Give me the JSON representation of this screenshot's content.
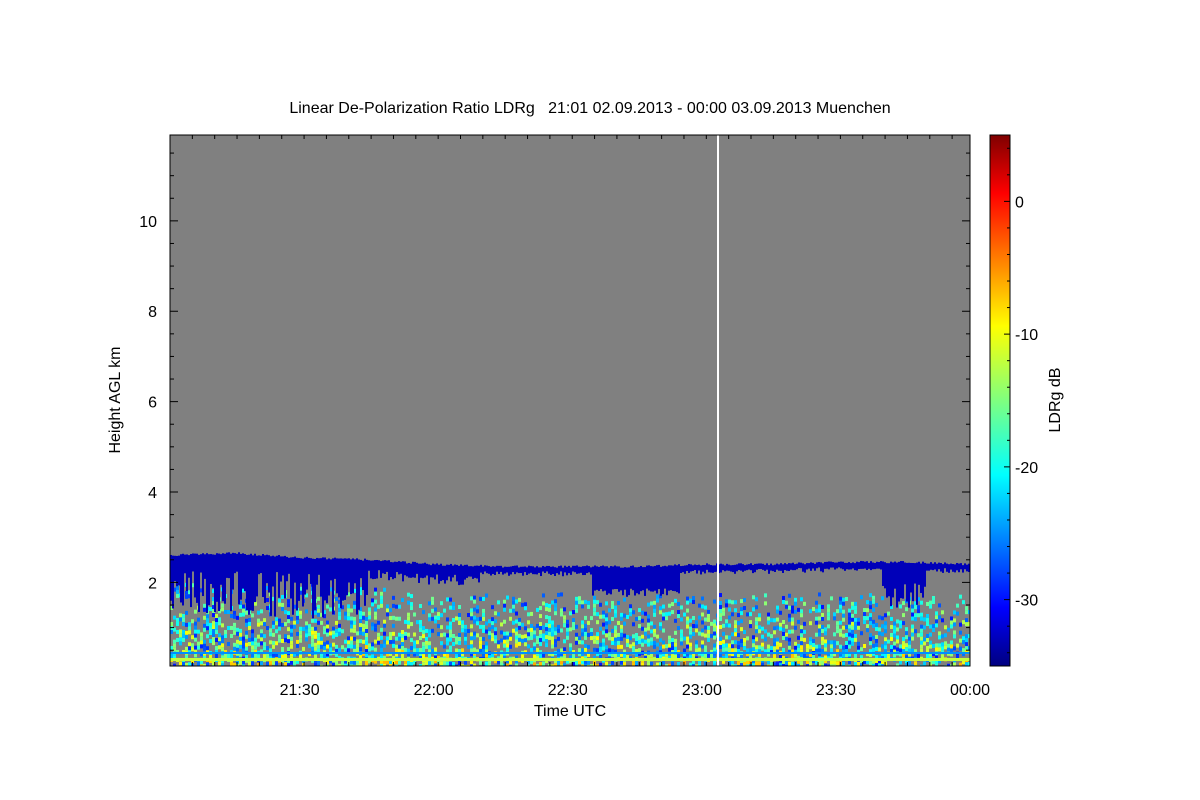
{
  "chart_data": {
    "type": "heatmap",
    "title": "Linear De-Polarization Ratio LDRg   21:01 02.09.2013 - 00:00 03.09.2013 Muenchen",
    "xlabel": "Time UTC",
    "ylabel": "Height AGL km",
    "xlim": [
      "21:01",
      "24:00"
    ],
    "ylim": [
      0.15,
      11.9
    ],
    "x_ticks": [
      "21:30",
      "22:00",
      "22:30",
      "23:00",
      "23:30",
      "00:00"
    ],
    "y_ticks": [
      2,
      4,
      6,
      8,
      10
    ],
    "colorbar": {
      "label": "LDRg dB",
      "range": [
        -35,
        5
      ],
      "ticks": [
        0,
        -10,
        -20,
        -30
      ],
      "colormap": "jet"
    },
    "background_color": "#808080",
    "no_data_line_time": "23:04",
    "cloud_layer": {
      "description_value": "LDRg about -33 dB",
      "top_km_by_time": [
        {
          "t": "21:01",
          "top": 2.6
        },
        {
          "t": "21:15",
          "top": 2.65
        },
        {
          "t": "21:30",
          "top": 2.55
        },
        {
          "t": "21:45",
          "top": 2.5
        },
        {
          "t": "22:00",
          "top": 2.4
        },
        {
          "t": "22:15",
          "top": 2.35
        },
        {
          "t": "22:30",
          "top": 2.35
        },
        {
          "t": "22:45",
          "top": 2.35
        },
        {
          "t": "23:00",
          "top": 2.4
        },
        {
          "t": "23:15",
          "top": 2.4
        },
        {
          "t": "23:30",
          "top": 2.45
        },
        {
          "t": "23:45",
          "top": 2.45
        },
        {
          "t": "24:00",
          "top": 2.4
        }
      ]
    },
    "boundary_layer": {
      "top_km": 1.8,
      "ldr_range_db": [
        -30,
        -5
      ]
    }
  }
}
